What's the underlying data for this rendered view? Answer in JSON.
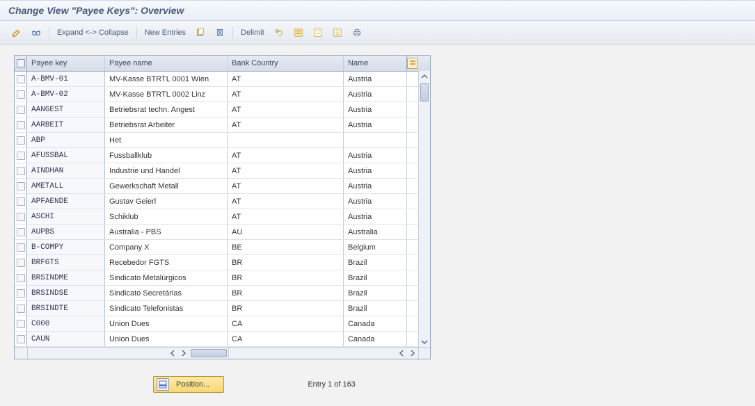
{
  "title": "Change View \"Payee Keys\": Overview",
  "toolbar": {
    "expand_collapse": "Expand <-> Collapse",
    "new_entries": "New Entries",
    "delimit": "Delimit"
  },
  "columns": {
    "payee_key": "Payee key",
    "payee_name": "Payee name",
    "bank_country": "Bank Country",
    "name": "Name"
  },
  "rows": [
    {
      "key": "A-BMV-01",
      "payee": "MV-Kasse  BTRTL 0001 Wien",
      "bc": "AT",
      "name": "Austria"
    },
    {
      "key": "A-BMV-02",
      "payee": "MV-Kasse  BTRTL 0002 Linz",
      "bc": "AT",
      "name": "Austria"
    },
    {
      "key": "AANGEST",
      "payee": "Betriebsrat techn. Angest",
      "bc": "AT",
      "name": "Austria"
    },
    {
      "key": "AARBEIT",
      "payee": "Betriebsrat Arbeiter",
      "bc": "AT",
      "name": "Austria"
    },
    {
      "key": "ABP",
      "payee": "Het",
      "bc": "",
      "name": ""
    },
    {
      "key": "AFUSSBAL",
      "payee": "Fussballklub",
      "bc": "AT",
      "name": "Austria"
    },
    {
      "key": "AINDHAN",
      "payee": "Industrie und Handel",
      "bc": "AT",
      "name": "Austria"
    },
    {
      "key": "AMETALL",
      "payee": "Gewerkschaft Metall",
      "bc": "AT",
      "name": "Austria"
    },
    {
      "key": "APFAENDE",
      "payee": "Gustav Geierl",
      "bc": "AT",
      "name": "Austria"
    },
    {
      "key": "ASCHI",
      "payee": "Schiklub",
      "bc": "AT",
      "name": "Austria"
    },
    {
      "key": "AUPBS",
      "payee": "Australia - PBS",
      "bc": "AU",
      "name": "Australia"
    },
    {
      "key": "B-COMPY",
      "payee": "Company X",
      "bc": "BE",
      "name": "Belgium"
    },
    {
      "key": "BRFGTS",
      "payee": "Recebedor FGTS",
      "bc": "BR",
      "name": "Brazil"
    },
    {
      "key": "BRSINDME",
      "payee": "Sindicato Metalúrgicos",
      "bc": "BR",
      "name": "Brazil"
    },
    {
      "key": "BRSINDSE",
      "payee": "Sindicato Secretárias",
      "bc": "BR",
      "name": "Brazil"
    },
    {
      "key": "BRSINDTE",
      "payee": "Sindicato Telefonistas",
      "bc": "BR",
      "name": "Brazil"
    },
    {
      "key": "C000",
      "payee": "Union Dues",
      "bc": "CA",
      "name": "Canada"
    },
    {
      "key": "CAUN",
      "payee": "Union Dues",
      "bc": "CA",
      "name": "Canada"
    }
  ],
  "footer": {
    "position_btn": "Position...",
    "entry_text": "Entry 1 of 163"
  },
  "watermark": ""
}
